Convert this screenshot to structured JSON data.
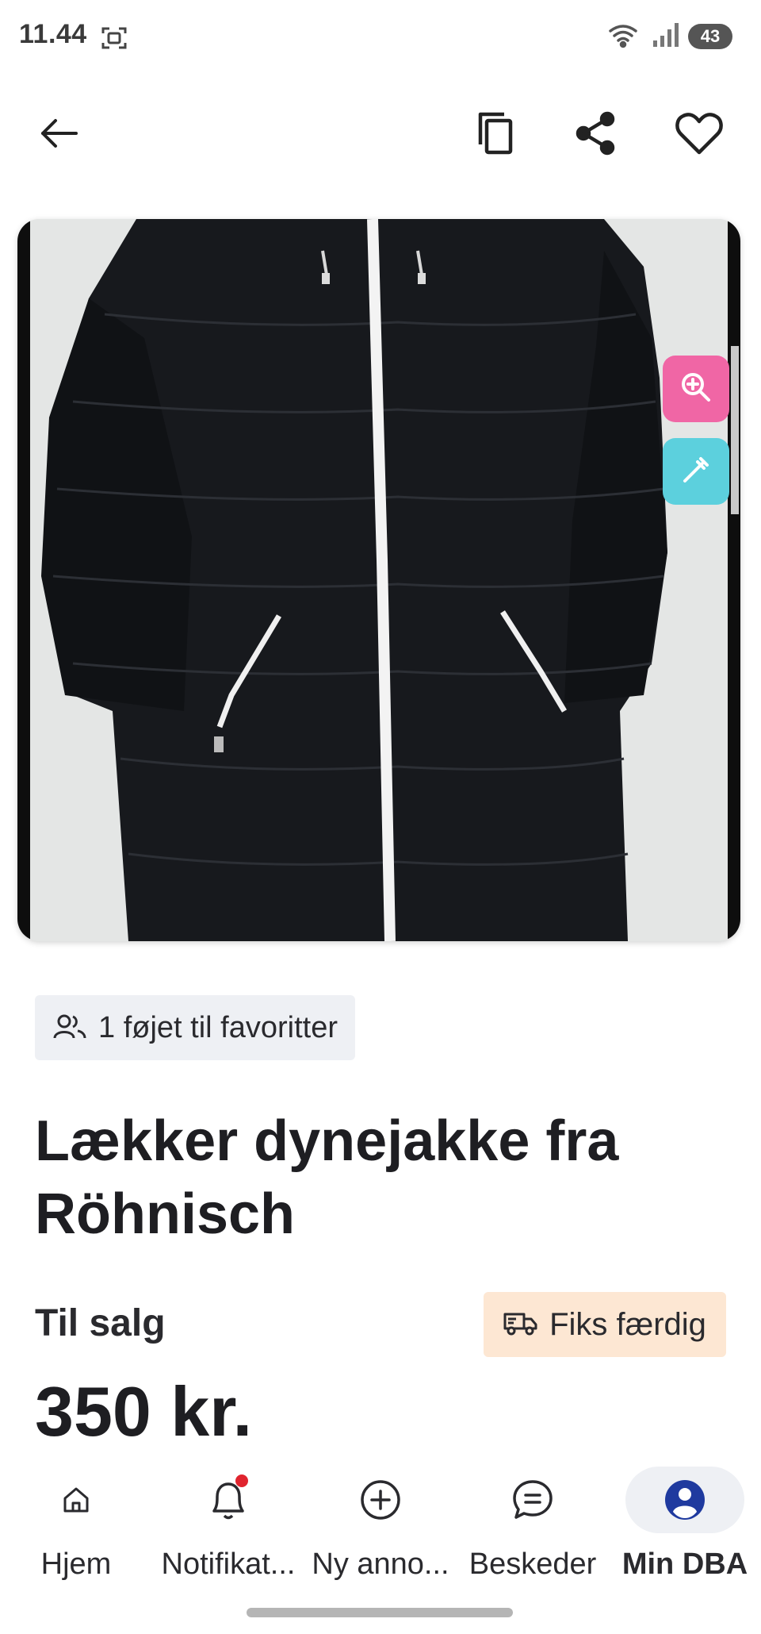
{
  "status_bar": {
    "time": "11.44",
    "battery": "43"
  },
  "header": {
    "back_icon": "arrow-left-icon",
    "copy_icon": "copy-icon",
    "share_icon": "share-icon",
    "favorite_icon": "heart-icon"
  },
  "image": {
    "zoom_icon": "zoom-in-icon",
    "picker_icon": "eyedropper-icon",
    "zoom_color": "#f066a5",
    "picker_color": "#5cd0dd"
  },
  "favorites": {
    "text": "1 føjet til favoritter"
  },
  "listing": {
    "title": "Lækker dynejakke fra Röhnisch",
    "status": "Til salg",
    "shipping_badge": "Fiks færdig",
    "shipping_badge_color": "#fde7d3",
    "price": "350 kr."
  },
  "bottom_nav": {
    "items": [
      {
        "label": "Hjem",
        "icon": "home-icon"
      },
      {
        "label": "Notifikat...",
        "icon": "bell-icon"
      },
      {
        "label": "Ny anno...",
        "icon": "plus-circle-icon"
      },
      {
        "label": "Beskeder",
        "icon": "chat-icon"
      },
      {
        "label": "Min DBA",
        "icon": "user-icon"
      }
    ],
    "active_color": "#1f3a9f"
  }
}
